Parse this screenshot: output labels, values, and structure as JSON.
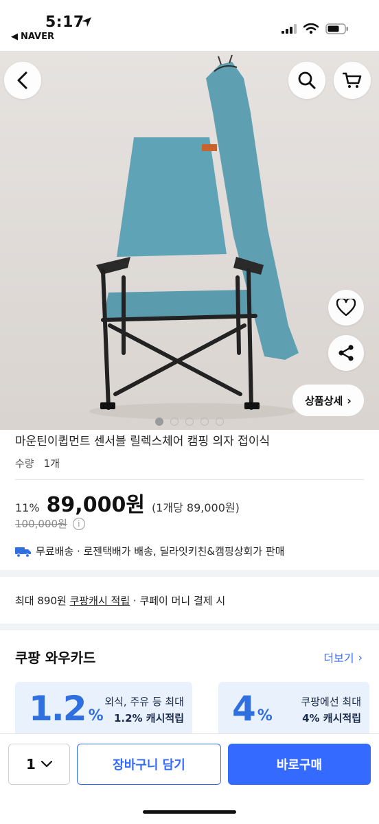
{
  "status_bar": {
    "time": "5:17",
    "back_app": "NAVER"
  },
  "product": {
    "title": "마운틴이큅먼트 센서블 릴렉스체어 캠핑 의자 접이식",
    "qty_label": "수량",
    "qty_value": "1개",
    "discount": "11%",
    "price": "89,000원",
    "unit_price": "(1개당 89,000원)",
    "original_price": "100,000원",
    "info_icon": "i",
    "shipping": "무료배송 · 로젠택배가 배송, 딜라잇키친&캠핑상회가 판매",
    "detail_button": "상품상세",
    "image_pages": 5,
    "image_active": 1
  },
  "cashback": {
    "prefix": "최대 890원 ",
    "link": "쿠팡캐시 적립",
    "suffix": " · 쿠페이 머니 결제 시"
  },
  "wow_card": {
    "title": "쿠팡 와우카드",
    "more": "더보기",
    "cards": [
      {
        "big": "1.2",
        "pct": "%",
        "line1": "외식, 주유 등 최대",
        "line2": "1.2% 캐시적립"
      },
      {
        "big": "4",
        "pct": "%",
        "line1": "쿠팡에선 최대",
        "line2": "4% 캐시적립"
      }
    ]
  },
  "bottom_bar": {
    "qty": "1",
    "cart_label": "장바구니 담기",
    "buy_label": "바로구매"
  },
  "colors": {
    "accent": "#346aff",
    "card_bg": "#e9f1fd",
    "chair_fabric": "#5fa3b6"
  }
}
